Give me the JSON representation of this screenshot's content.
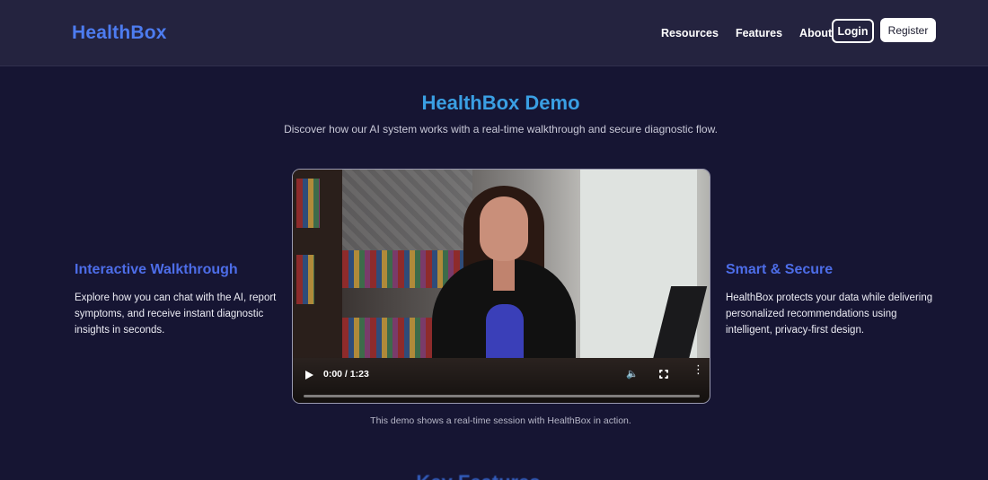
{
  "header": {
    "brand": "HealthBox",
    "nav": [
      {
        "label": "Resources"
      },
      {
        "label": "Features"
      },
      {
        "label": "About"
      }
    ],
    "login_label": "Login",
    "register_label": "Register"
  },
  "hero": {
    "title": "HealthBox Demo",
    "subtitle": "Discover how our AI system works with a real-time walkthrough and secure diagnostic flow."
  },
  "left_feature": {
    "title": "Interactive Walkthrough",
    "text": "Explore how you can chat with the AI, report symptoms, and receive instant diagnostic insights in seconds."
  },
  "right_feature": {
    "title": "Smart & Secure",
    "text": "HealthBox protects your data while delivering personalized recommendations using intelligent, privacy-first design."
  },
  "video": {
    "time": "0:00 / 1:23",
    "progress": 0,
    "caption": "This demo shows a real-time session with HealthBox in action."
  },
  "next_section": {
    "title": "Key Features"
  },
  "colors": {
    "background": "#161533",
    "brand": "#4d7cf0",
    "title": "#3a9fe3",
    "feature_heading": "#4d6de8"
  }
}
